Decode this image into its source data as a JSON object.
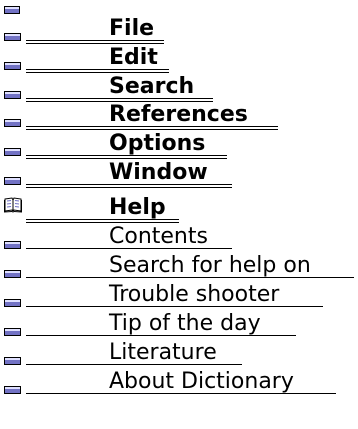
{
  "colors": {
    "bar_icon_fill": "#7272c4",
    "bar_icon_highlight": "#dfe0ff",
    "text": "#000000",
    "background": "#ffffff"
  },
  "top_icon": "bar-icon",
  "menu_items": [
    {
      "label": "File",
      "icon": "bar-icon"
    },
    {
      "label": "Edit",
      "icon": "bar-icon"
    },
    {
      "label": "Search",
      "icon": "bar-icon"
    },
    {
      "label": "References",
      "icon": "bar-icon"
    },
    {
      "label": "Options",
      "icon": "bar-icon"
    },
    {
      "label": "Window",
      "icon": "bar-icon"
    }
  ],
  "help": {
    "label": "Help",
    "icon": "book-icon"
  },
  "help_items": [
    {
      "label": "Contents",
      "icon": "bar-icon"
    },
    {
      "label": "Search for help on",
      "icon": "bar-icon"
    },
    {
      "label": "Trouble shooter",
      "icon": "bar-icon"
    },
    {
      "label": "Tip of the day",
      "icon": "bar-icon"
    },
    {
      "label": "Literature",
      "icon": "bar-icon"
    },
    {
      "label": "About Dictionary",
      "icon": "bar-icon"
    }
  ]
}
